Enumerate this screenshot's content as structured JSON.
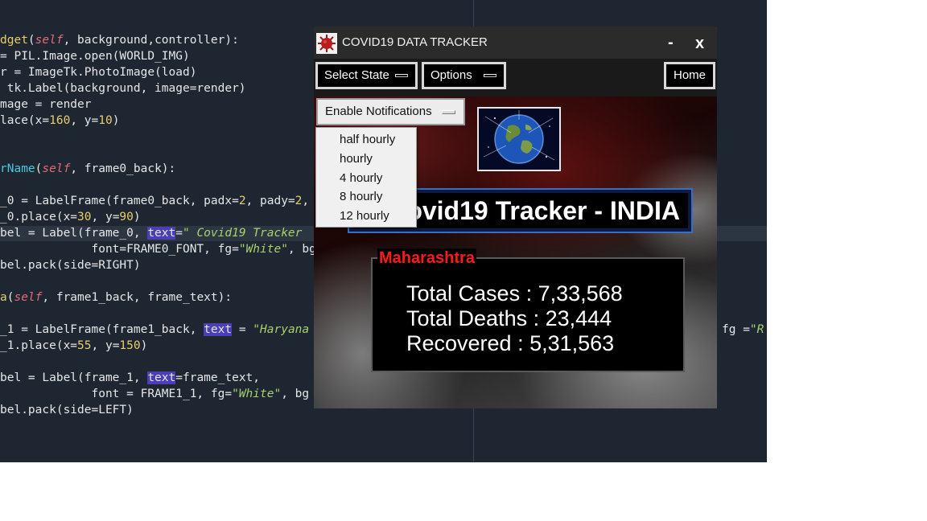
{
  "editor": {
    "lines": [
      {
        "segments": [
          {
            "t": "dget",
            "c": "fn"
          },
          {
            "t": "(",
            "c": ""
          },
          {
            "t": "self",
            "c": "self"
          },
          {
            "t": ", background,controller):",
            "c": ""
          }
        ]
      },
      {
        "segments": [
          {
            "t": "= PIL.Image.open(WORLD_IMG)",
            "c": ""
          }
        ]
      },
      {
        "segments": [
          {
            "t": "r = ImageTk.PhotoImage(load)",
            "c": ""
          }
        ]
      },
      {
        "segments": [
          {
            "t": " tk.Label(background, image=render)",
            "c": ""
          }
        ]
      },
      {
        "segments": [
          {
            "t": "mage = render",
            "c": ""
          }
        ]
      },
      {
        "segments": [
          {
            "t": "lace(x=",
            "c": ""
          },
          {
            "t": "160",
            "c": "num"
          },
          {
            "t": ", y=",
            "c": ""
          },
          {
            "t": "10",
            "c": "num"
          },
          {
            "t": ")",
            "c": ""
          }
        ]
      },
      {
        "segments": []
      },
      {
        "segments": []
      },
      {
        "segments": [
          {
            "t": "rName",
            "c": "fn2"
          },
          {
            "t": "(",
            "c": ""
          },
          {
            "t": "self",
            "c": "self"
          },
          {
            "t": ", frame0_back):",
            "c": ""
          }
        ]
      },
      {
        "segments": []
      },
      {
        "segments": [
          {
            "t": "_0 = LabelFrame(frame0_back, padx=",
            "c": ""
          },
          {
            "t": "2",
            "c": "num"
          },
          {
            "t": ", pady=",
            "c": ""
          },
          {
            "t": "2",
            "c": "num"
          },
          {
            "t": ",",
            "c": ""
          }
        ]
      },
      {
        "segments": [
          {
            "t": "_0.place(x=",
            "c": ""
          },
          {
            "t": "30",
            "c": "num"
          },
          {
            "t": ", y=",
            "c": ""
          },
          {
            "t": "90",
            "c": "num"
          },
          {
            "t": ")",
            "c": ""
          }
        ]
      },
      {
        "segments": [
          {
            "t": "bel = Label(frame_0, ",
            "c": ""
          },
          {
            "t": "text",
            "c": "kw"
          },
          {
            "t": "=",
            "c": ""
          },
          {
            "t": "\" Covid19 Tracker",
            "c": "str"
          }
        ]
      },
      {
        "segments": [
          {
            "t": "             font=FRAME0_FONT, fg=",
            "c": ""
          },
          {
            "t": "\"White\"",
            "c": "str"
          },
          {
            "t": ", bg",
            "c": ""
          }
        ]
      },
      {
        "segments": [
          {
            "t": "bel.pack(side=RIGHT)",
            "c": ""
          }
        ]
      },
      {
        "segments": []
      },
      {
        "segments": [
          {
            "t": "a",
            "c": "yel"
          },
          {
            "t": "(",
            "c": ""
          },
          {
            "t": "self",
            "c": "self"
          },
          {
            "t": ", frame1_back, frame_text):",
            "c": ""
          }
        ]
      },
      {
        "segments": []
      },
      {
        "segments": [
          {
            "t": "_1 = LabelFrame(frame1_back, ",
            "c": ""
          },
          {
            "t": "text",
            "c": "kw"
          },
          {
            "t": " = ",
            "c": ""
          },
          {
            "t": "\"Haryana",
            "c": "str"
          }
        ]
      },
      {
        "segments": [
          {
            "t": "_1.place(x=",
            "c": ""
          },
          {
            "t": "55",
            "c": "num"
          },
          {
            "t": ", y=",
            "c": ""
          },
          {
            "t": "150",
            "c": "num"
          },
          {
            "t": ")",
            "c": ""
          }
        ]
      },
      {
        "segments": []
      },
      {
        "segments": [
          {
            "t": "bel = Label(frame_1, ",
            "c": ""
          },
          {
            "t": "text",
            "c": "kw"
          },
          {
            "t": "=frame_text,",
            "c": ""
          }
        ]
      },
      {
        "segments": [
          {
            "t": "             font = FRAME1_1, fg=",
            "c": ""
          },
          {
            "t": "\"White\"",
            "c": "str"
          },
          {
            "t": ", bg",
            "c": ""
          }
        ]
      },
      {
        "segments": [
          {
            "t": "bel.pack(side=LEFT)",
            "c": ""
          }
        ]
      }
    ],
    "right_fragment": [
      {
        "t": "fg =",
        "c": ""
      },
      {
        "t": "\"R",
        "c": "str"
      }
    ]
  },
  "app": {
    "title": "COVID19 DATA TRACKER",
    "minimize_label": "-",
    "close_label": "x",
    "menu": {
      "select_state": "Select State",
      "options": "Options",
      "home": "Home"
    },
    "notifications_label": "Enable Notifications",
    "notification_options": [
      "half hourly",
      "hourly",
      "4 hourly",
      "8 hourly",
      "12 hourly"
    ],
    "tracker_title": "Covid19 Tracker - INDIA",
    "state": "Maharashtra",
    "stats": {
      "total_cases": "Total Cases : 7,33,568",
      "total_deaths": "Total Deaths : 23,444",
      "recovered": "Recovered : 5,31,563"
    }
  },
  "colors": {
    "editor_bg": "#1e2632",
    "state_label": "#ff1a1a",
    "title_frame_border": "#3a6fc0"
  }
}
